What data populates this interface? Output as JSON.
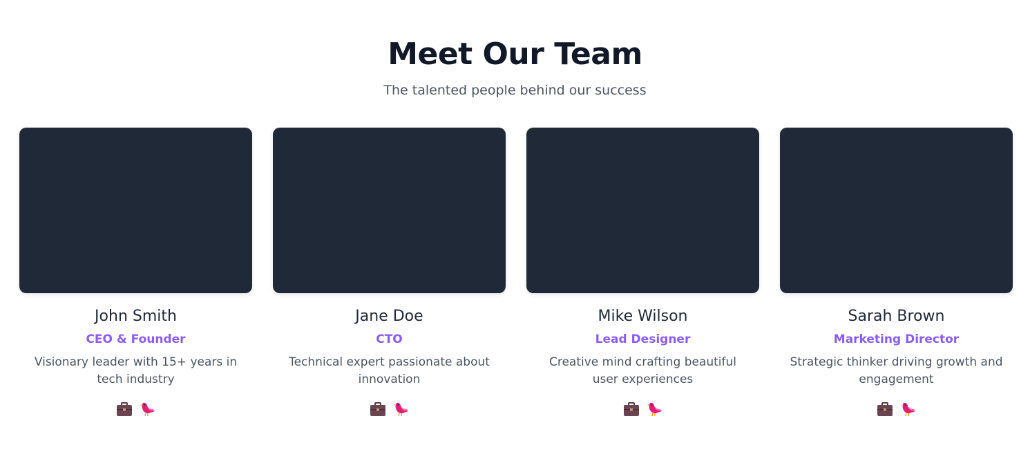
{
  "section": {
    "title": "Meet Our Team",
    "subtitle": "The talented people behind our success"
  },
  "team": [
    {
      "name": "John Smith",
      "role": "CEO & Founder",
      "bio": "Visionary leader with 15+ years in tech industry",
      "social": [
        "briefcase-icon",
        "bird-icon"
      ]
    },
    {
      "name": "Jane Doe",
      "role": "CTO",
      "bio": "Technical expert passionate about innovation",
      "social": [
        "briefcase-icon",
        "bird-icon"
      ]
    },
    {
      "name": "Mike Wilson",
      "role": "Lead Designer",
      "bio": "Creative mind crafting beautiful user experiences",
      "social": [
        "briefcase-icon",
        "bird-icon"
      ]
    },
    {
      "name": "Sarah Brown",
      "role": "Marketing Director",
      "bio": "Strategic thinker driving growth and engagement",
      "social": [
        "briefcase-icon",
        "bird-icon"
      ]
    }
  ],
  "colors": {
    "photo_placeholder": "#1f2937",
    "accent": "#8b5cf6",
    "heading": "#111827",
    "body_text": "#4b5563"
  }
}
